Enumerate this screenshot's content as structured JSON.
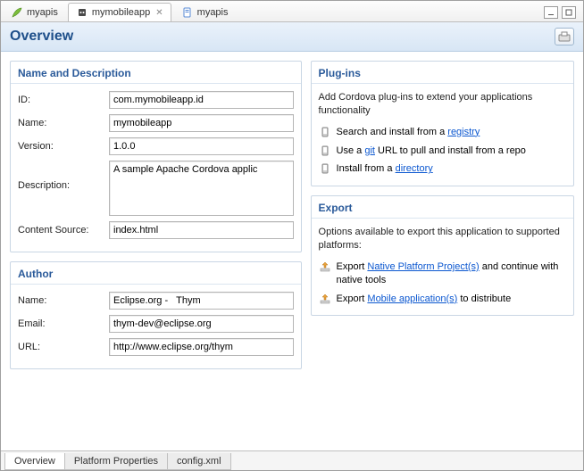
{
  "editorTabs": [
    {
      "label": "myapis",
      "active": false
    },
    {
      "label": "mymobileapp",
      "active": true
    },
    {
      "label": "myapis",
      "active": false
    }
  ],
  "page": {
    "title": "Overview"
  },
  "nameDesc": {
    "heading": "Name and Description",
    "labels": {
      "id": "ID:",
      "name": "Name:",
      "version": "Version:",
      "description": "Description:",
      "contentSource": "Content Source:"
    },
    "values": {
      "id": "com.mymobileapp.id",
      "name": "mymobileapp",
      "version": "1.0.0",
      "description": "A sample Apache Cordova applic",
      "contentSource": "index.html"
    }
  },
  "author": {
    "heading": "Author",
    "labels": {
      "name": "Name:",
      "email": "Email:",
      "url": "URL:"
    },
    "values": {
      "name": "Eclipse.org -   Thym",
      "email": "thym-dev@eclipse.org",
      "url": "http://www.eclipse.org/thym"
    }
  },
  "plugins": {
    "heading": "Plug-ins",
    "intro": "Add Cordova plug-ins to extend your applications functionality",
    "items": [
      {
        "pre": "Search and install from a ",
        "link": "registry",
        "post": ""
      },
      {
        "pre": "Use a ",
        "link": "git",
        "post": " URL to pull and install from a repo"
      },
      {
        "pre": "Install from a ",
        "link": "directory",
        "post": ""
      }
    ]
  },
  "export": {
    "heading": "Export",
    "intro": "Options available to export this application to supported platforms:",
    "items": [
      {
        "pre": "Export ",
        "link": "Native Platform Project(s)",
        "post": " and continue with native tools"
      },
      {
        "pre": "Export ",
        "link": "Mobile application(s)",
        "post": " to distribute"
      }
    ]
  },
  "bottomTabs": [
    {
      "label": "Overview",
      "active": true
    },
    {
      "label": "Platform Properties",
      "active": false
    },
    {
      "label": "config.xml",
      "active": false
    }
  ]
}
